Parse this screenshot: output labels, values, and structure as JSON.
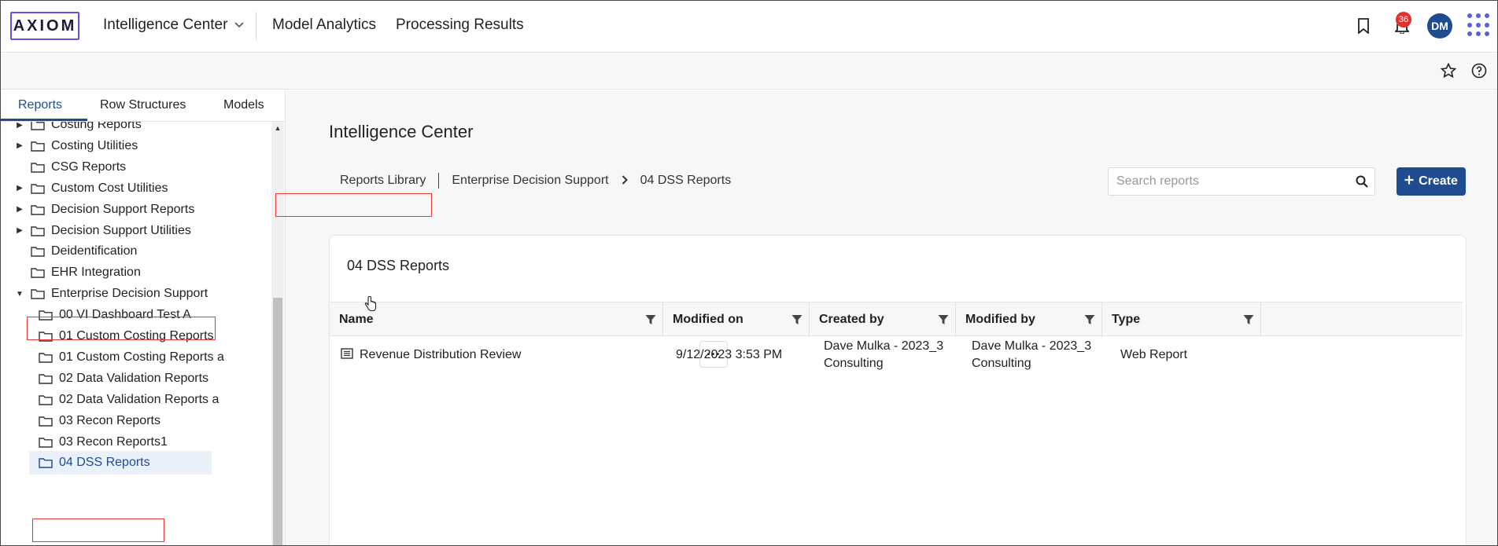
{
  "header": {
    "logo_text": "AXIOM",
    "app_switcher": "Intelligence Center",
    "nav": [
      "Model Analytics",
      "Processing Results"
    ],
    "notification_count": "36",
    "avatar_initials": "DM"
  },
  "sidebar": {
    "tabs": [
      "Reports",
      "Row Structures",
      "Models"
    ],
    "active_tab": "Reports",
    "tree": [
      {
        "label": "Costing Reports",
        "caret": "right",
        "indent": 0
      },
      {
        "label": "Costing Utilities",
        "caret": "right",
        "indent": 0
      },
      {
        "label": "CSG Reports",
        "caret": "none",
        "indent": 0
      },
      {
        "label": "Custom Cost Utilities",
        "caret": "right",
        "indent": 0
      },
      {
        "label": "Decision Support Reports",
        "caret": "right",
        "indent": 0
      },
      {
        "label": "Decision Support Utilities",
        "caret": "right",
        "indent": 0
      },
      {
        "label": "Deidentification",
        "caret": "none",
        "indent": 0
      },
      {
        "label": "EHR Integration",
        "caret": "none",
        "indent": 0
      },
      {
        "label": "Enterprise Decision Support",
        "caret": "down",
        "indent": 0
      },
      {
        "label": "00 VI Dashboard Test A",
        "caret": "none",
        "indent": 1
      },
      {
        "label": "01 Custom Costing Reports",
        "caret": "none",
        "indent": 1
      },
      {
        "label": "01 Custom Costing Reports a",
        "caret": "none",
        "indent": 1
      },
      {
        "label": "02 Data Validation Reports",
        "caret": "none",
        "indent": 1
      },
      {
        "label": "02 Data Validation Reports a",
        "caret": "none",
        "indent": 1
      },
      {
        "label": "03 Recon Reports",
        "caret": "none",
        "indent": 1
      },
      {
        "label": "03 Recon Reports1",
        "caret": "none",
        "indent": 1
      },
      {
        "label": "04 DSS Reports",
        "caret": "none",
        "indent": 1,
        "selected": true
      }
    ]
  },
  "main": {
    "title": "Intelligence Center",
    "breadcrumb": [
      "Reports Library",
      "Enterprise Decision Support",
      "04 DSS Reports"
    ],
    "search_placeholder": "Search reports",
    "create_label": "Create",
    "card_title": "04 DSS Reports",
    "columns": [
      "Name",
      "Modified on",
      "Created by",
      "Modified by",
      "Type"
    ],
    "rows": [
      {
        "name": "Revenue Distribution Review",
        "modified_on": "9/12/2023 3:53 PM",
        "created_by_line1": "Dave Mulka - 2023_3",
        "created_by_line2": "Consulting",
        "modified_by_line1": "Dave Mulka - 2023_3",
        "modified_by_line2": "Consulting",
        "type": "Web Report"
      }
    ]
  },
  "colors": {
    "primary": "#1e4c8f",
    "logo_border": "#6b4fd8",
    "highlight": "#e53935",
    "badge": "#e0312f"
  }
}
